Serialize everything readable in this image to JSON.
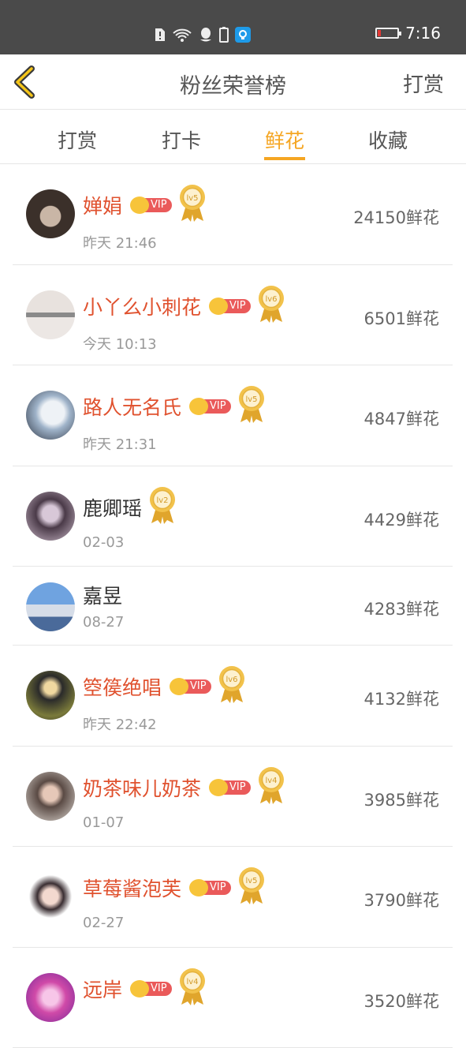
{
  "status_bar": {
    "time": "7:16"
  },
  "header": {
    "title": "粉丝荣誉榜",
    "right_action": "打赏"
  },
  "tabs": [
    {
      "label": "打赏",
      "active": false
    },
    {
      "label": "打卡",
      "active": false
    },
    {
      "label": "鲜花",
      "active": true
    },
    {
      "label": "收藏",
      "active": false
    }
  ],
  "vip_label": "VIP",
  "fans": [
    {
      "name": "婵娟",
      "vip": true,
      "level": "lv5",
      "time": "昨天 21:46",
      "count": "24150鲜花"
    },
    {
      "name": "小丫么小刺花",
      "vip": true,
      "level": "lv6",
      "time": "今天 10:13",
      "count": "6501鲜花"
    },
    {
      "name": "路人无名氏",
      "vip": true,
      "level": "lv5",
      "time": "昨天 21:31",
      "count": "4847鲜花"
    },
    {
      "name": "鹿卿瑶",
      "vip": false,
      "level": "lv2",
      "time": "02-03",
      "count": "4429鲜花"
    },
    {
      "name": "嘉昱",
      "vip": false,
      "level": "",
      "time": "08-27",
      "count": "4283鲜花"
    },
    {
      "name": "箜篌绝唱",
      "vip": true,
      "level": "lv6",
      "time": "昨天 22:42",
      "count": "4132鲜花"
    },
    {
      "name": "奶茶味儿奶茶",
      "vip": true,
      "level": "lv4",
      "time": "01-07",
      "count": "3985鲜花"
    },
    {
      "name": "草莓酱泡芙",
      "vip": true,
      "level": "lv5",
      "time": "02-27",
      "count": "3790鲜花"
    },
    {
      "name": "远岸",
      "vip": true,
      "level": "lv4",
      "time": "",
      "count": "3520鲜花"
    }
  ],
  "colors": {
    "accent": "#f5a623",
    "vip_name": "#e0522f",
    "status_bar": "#4a4a4a"
  }
}
